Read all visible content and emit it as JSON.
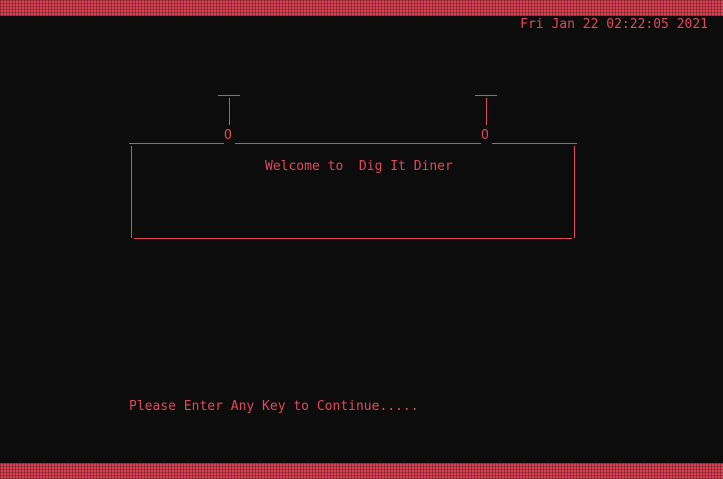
{
  "screen": {
    "datetime": "Fri Jan 22 02:22:05 2021",
    "sign_text": "Welcome to  Dig It Diner",
    "prompt": "Please Enter Any Key to Continue.....",
    "ring_glyph": "O"
  },
  "colors": {
    "background": "#0c0c0c",
    "text": "#e0485b",
    "border": "#d84152"
  }
}
